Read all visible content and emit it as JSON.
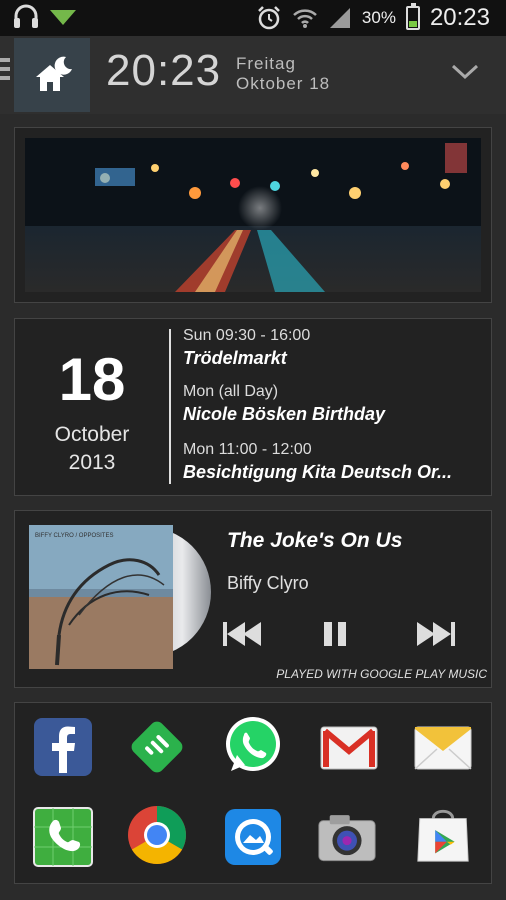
{
  "status_bar": {
    "battery_percent": "30%",
    "time": "20:23",
    "battery_level": 0.3,
    "icons": [
      "headphones-icon",
      "download-icon",
      "alarm-icon",
      "wifi-icon",
      "signal-icon",
      "battery-icon"
    ]
  },
  "header": {
    "time": "20:23",
    "weekday": "Freitag",
    "date": "Oktober 18",
    "icons": [
      "menu-icon",
      "home-night-icon",
      "chevron-down-icon"
    ]
  },
  "calendar": {
    "day": "18",
    "month": "October",
    "year": "2013",
    "events": [
      {
        "time": "Sun 09:30 - 16:00",
        "title": "Trödelmarkt"
      },
      {
        "time": "Mon (all Day)",
        "title": "Nicole Bösken Birthday"
      },
      {
        "time": "Mon 11:00 - 12:00",
        "title": "Besichtigung Kita Deutsch Or..."
      }
    ]
  },
  "music": {
    "song": "The Joke's On Us",
    "artist": "Biffy Clyro",
    "album_art_text": "BIFFY CLYRO / OPPOSITES",
    "credit": "PLAYED WITH GOOGLE PLAY MUSIC",
    "controls": [
      "previous-icon",
      "pause-icon",
      "next-icon"
    ]
  },
  "apps": [
    {
      "name": "facebook-icon",
      "color": "#3b5998"
    },
    {
      "name": "feedly-icon",
      "color": "#2bb24c"
    },
    {
      "name": "whatsapp-icon",
      "color": "#25d366"
    },
    {
      "name": "gmail-icon",
      "color": "#d93025"
    },
    {
      "name": "email-icon",
      "color": "#f2c23a"
    },
    {
      "name": "phone-icon",
      "color": "#3fae3f"
    },
    {
      "name": "chrome-icon",
      "color": "#db4437"
    },
    {
      "name": "quickpic-icon",
      "color": "#1e88e5"
    },
    {
      "name": "camera-icon",
      "color": "#9e9e9e"
    },
    {
      "name": "play-store-icon",
      "color": "#34a853"
    }
  ]
}
